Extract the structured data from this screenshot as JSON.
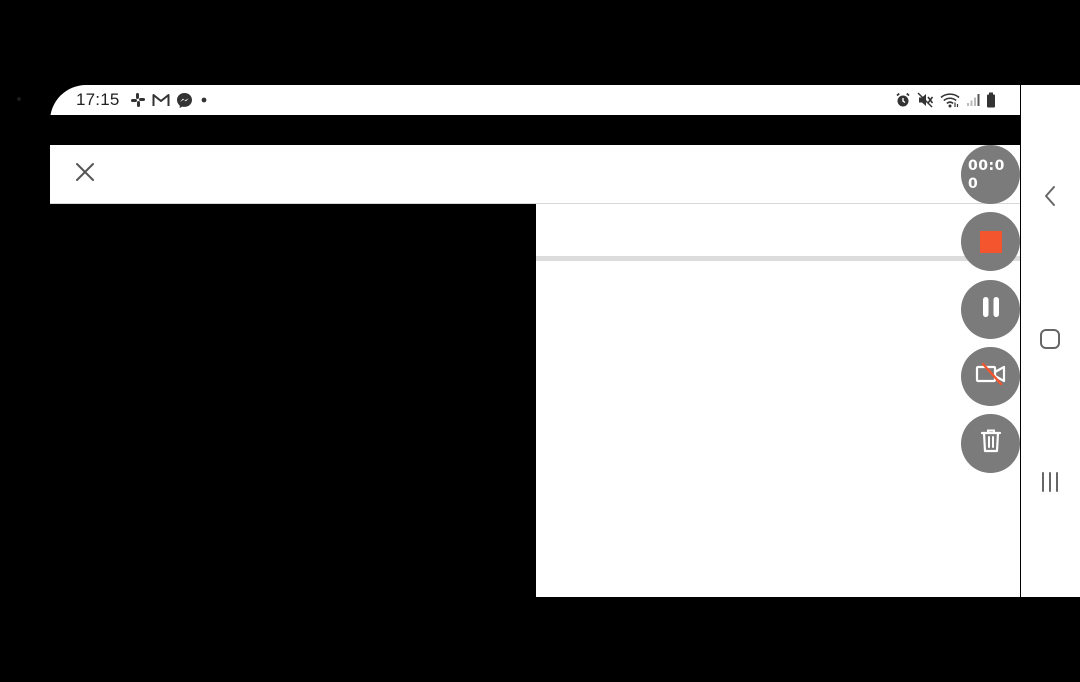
{
  "status_bar": {
    "time": "17:15",
    "notification_icons": [
      "slack-icon",
      "gmail-icon",
      "messenger-icon",
      "more-dot-icon"
    ],
    "system_icons": [
      "alarm-icon",
      "mute-icon",
      "wifi-icon",
      "signal-icon",
      "battery-icon"
    ]
  },
  "toolbar": {
    "close_icon": "close-icon"
  },
  "recorder": {
    "timer": "00:00",
    "stop_color": "#f4552f",
    "button_color": "#7b7b7b",
    "buttons": [
      "stop-icon",
      "pause-icon",
      "camera-off-icon",
      "trash-icon"
    ]
  },
  "navigation_bar": {
    "buttons": [
      "back-icon",
      "home-icon",
      "recents-icon"
    ]
  }
}
